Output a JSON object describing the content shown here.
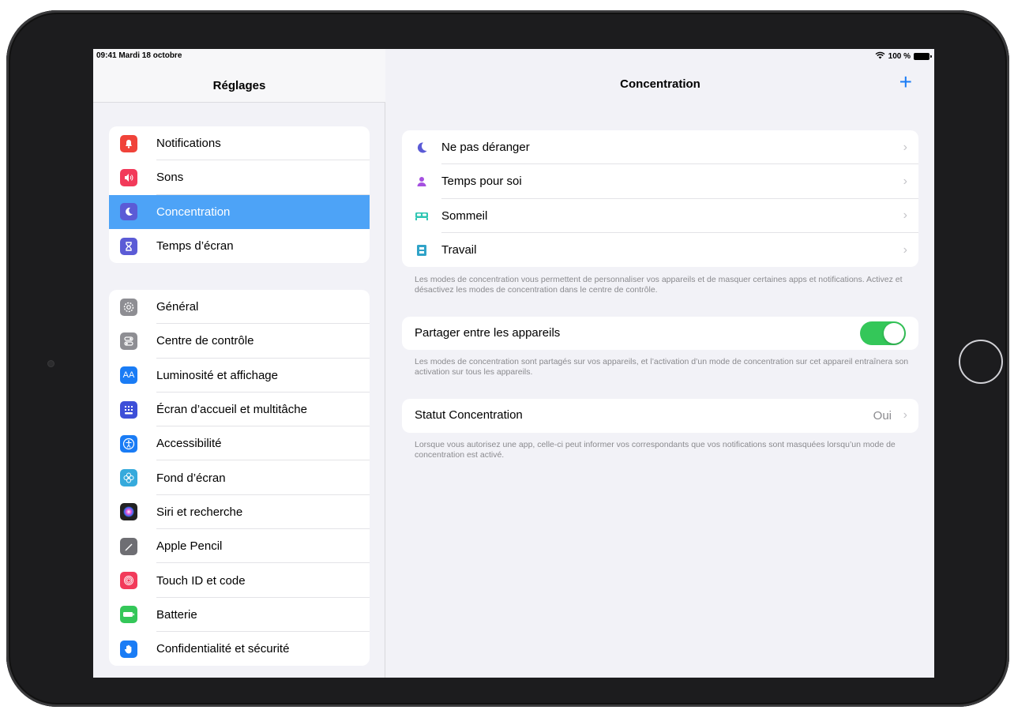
{
  "status_bar": {
    "time_date": "09:41  Mardi 18 octobre",
    "battery": "100 %",
    "wifi_icon": "wifi-icon",
    "battery_icon": "battery-icon"
  },
  "sidebar": {
    "title": "Réglages",
    "groups": [
      {
        "items": [
          {
            "label": "Notifications",
            "icon": "notifications-icon",
            "color": "#f0433a"
          },
          {
            "label": "Sons",
            "icon": "speaker-icon",
            "color": "#f23a5a"
          },
          {
            "label": "Concentration",
            "icon": "moon-icon",
            "color": "#5b5bd6",
            "selected": true
          },
          {
            "label": "Temps d’écran",
            "icon": "hourglass-icon",
            "color": "#5b5bd6"
          }
        ]
      },
      {
        "items": [
          {
            "label": "Général",
            "icon": "gear-icon",
            "color": "#8e8e93"
          },
          {
            "label": "Centre de contrôle",
            "icon": "switches-icon",
            "color": "#8e8e93"
          },
          {
            "label": "Luminosité et affichage",
            "icon": "text-size-icon",
            "color": "#1a7cf5"
          },
          {
            "label": "Écran d’accueil et multitâche",
            "icon": "home-grid-icon",
            "color": "#3d4fd8"
          },
          {
            "label": "Accessibilité",
            "icon": "accessibility-icon",
            "color": "#1a7cf5"
          },
          {
            "label": "Fond d’écran",
            "icon": "flower-icon",
            "color": "#36aadc"
          },
          {
            "label": "Siri et recherche",
            "icon": "siri-icon",
            "color": "#222"
          },
          {
            "label": "Apple Pencil",
            "icon": "pencil-icon",
            "color": "#6e6e73"
          },
          {
            "label": "Touch ID et code",
            "icon": "fingerprint-icon",
            "color": "#f23a5a"
          },
          {
            "label": "Batterie",
            "icon": "battery-setting-icon",
            "color": "#34c759"
          },
          {
            "label": "Confidentialité et sécurité",
            "icon": "hand-icon",
            "color": "#1a7cf5"
          }
        ]
      }
    ]
  },
  "main": {
    "title": "Concentration",
    "add_label": "+",
    "modes": [
      {
        "label": "Ne pas déranger",
        "icon": "moon-icon",
        "color": "#5b5bd6"
      },
      {
        "label": "Temps pour soi",
        "icon": "person-icon",
        "color": "#a550e0"
      },
      {
        "label": "Sommeil",
        "icon": "bed-icon",
        "color": "#2fc6b3"
      },
      {
        "label": "Travail",
        "icon": "badge-icon",
        "color": "#30a3c8"
      }
    ],
    "modes_note": "Les modes de concentration vous permettent de personnaliser vos appareils et de masquer certaines apps et notifications. Activez et désactivez les modes de concentration dans le centre de contrôle.",
    "share_label": "Partager entre les appareils",
    "share_enabled": true,
    "share_note": "Les modes de concentration sont partagés sur vos appareils, et l’activation d’un mode de concentration sur cet appareil entraînera son activation sur tous les appareils.",
    "status_label": "Statut Concentration",
    "status_value": "Oui",
    "status_note": "Lorsque vous autorisez une app, celle-ci peut informer vos correspondants que vos notifications sont masquées lorsqu’un mode de concentration est activé."
  }
}
